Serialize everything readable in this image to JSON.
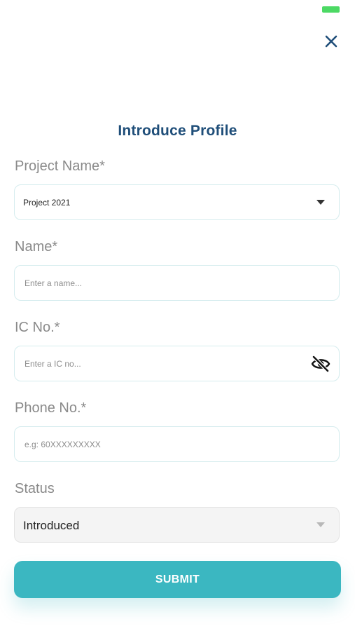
{
  "status_bar": {
    "battery_color": "#4cd964"
  },
  "header": {
    "close_icon": "close-icon",
    "title": "Introduce Profile"
  },
  "form": {
    "project": {
      "label": "Project Name*",
      "value": "Project 2021",
      "icon": "caret-down-icon"
    },
    "name": {
      "label": "Name*",
      "placeholder": "Enter a name..."
    },
    "ic": {
      "label": "IC No.*",
      "placeholder": "Enter a IC no...",
      "icon": "eye-off-icon"
    },
    "phone": {
      "label": "Phone No.*",
      "placeholder": "e.g: 60XXXXXXXXX"
    },
    "status": {
      "label": "Status",
      "value": "Introduced",
      "icon": "caret-down-icon"
    },
    "submit_label": "SUBMIT"
  },
  "colors": {
    "title": "#1f4e79",
    "accent": "#3bb7c1",
    "border": "#d5ecee"
  }
}
